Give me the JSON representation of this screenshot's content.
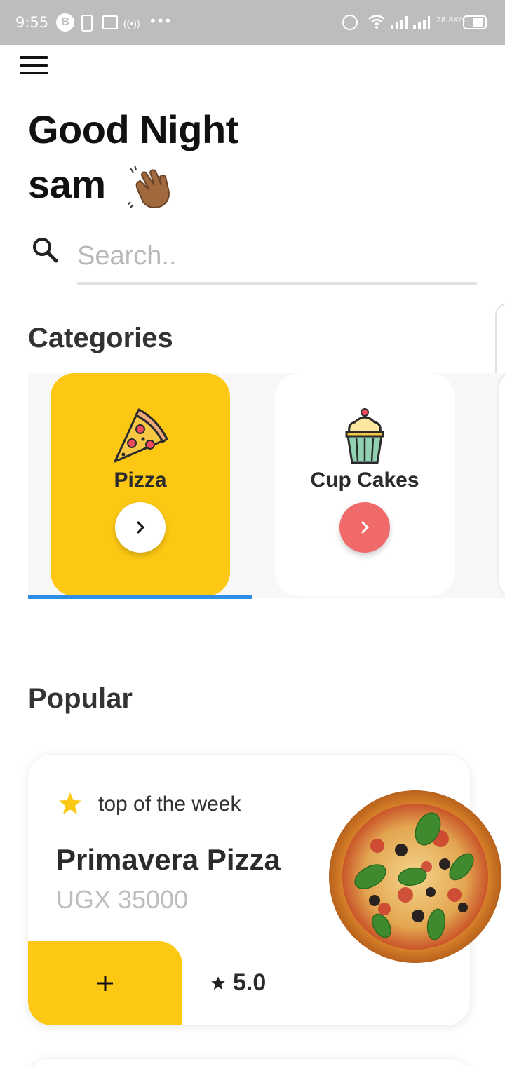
{
  "status_bar": {
    "time": "9:55",
    "network_speed_value": "28.8",
    "network_speed_unit": "K/s"
  },
  "greeting": {
    "line1": "Good Night",
    "line2": "sam"
  },
  "search": {
    "placeholder": "Search.."
  },
  "categories": {
    "title": "Categories",
    "items": [
      {
        "label": "Pizza",
        "icon": "pizza-icon",
        "selected": true
      },
      {
        "label": "Cup Cakes",
        "icon": "cupcake-icon",
        "selected": false
      }
    ]
  },
  "popular": {
    "title": "Popular",
    "card": {
      "tag": "top of the week",
      "name": "Primavera Pizza",
      "price": "UGX 35000",
      "add_label": "+",
      "rating": "5.0"
    }
  },
  "colors": {
    "accent_yellow": "#fcc813",
    "accent_red": "#f06a6a",
    "indicator_blue": "#2f8ee6"
  }
}
